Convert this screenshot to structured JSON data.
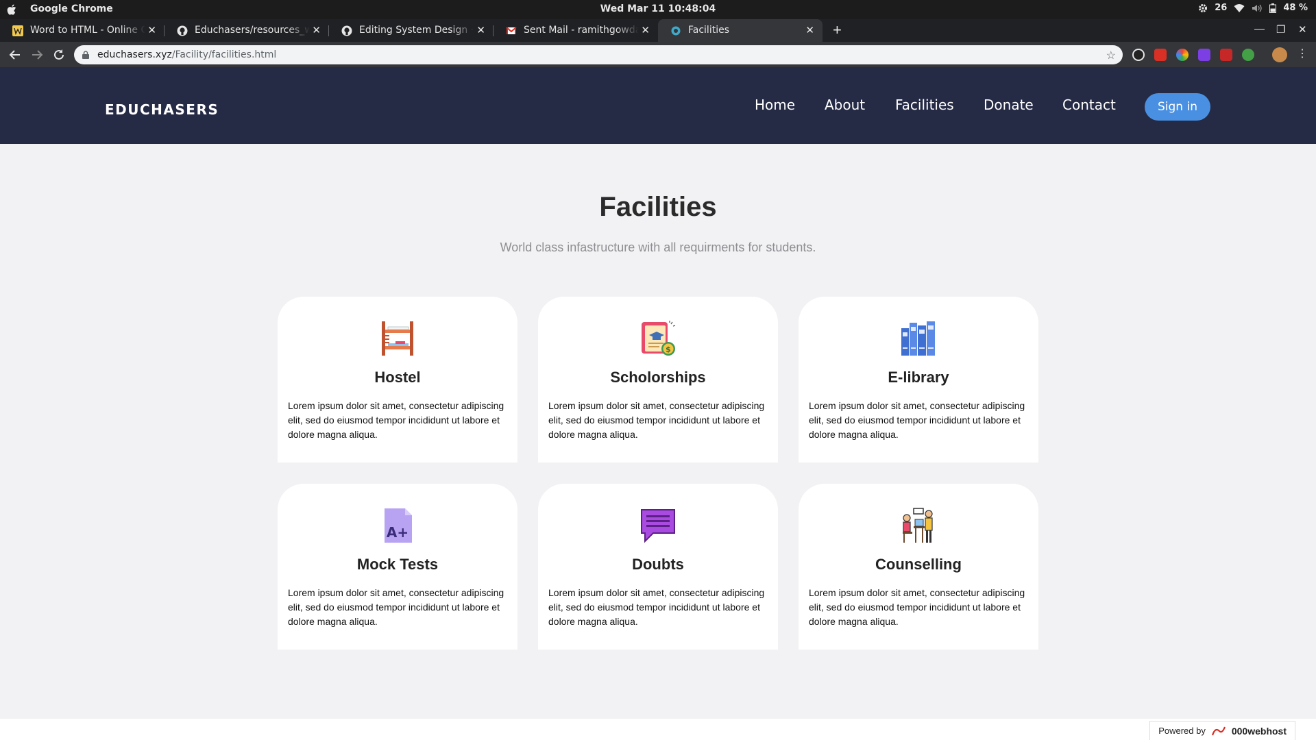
{
  "os": {
    "app_name": "Google Chrome",
    "clock": "Wed Mar 11  10:48:04",
    "tray_count": "26",
    "battery": "48 %"
  },
  "browser": {
    "tabs": [
      {
        "title": "Word to HTML - Online Co",
        "favicon": "w-icon"
      },
      {
        "title": "Educhasers/resources_wi",
        "favicon": "github-icon"
      },
      {
        "title": "Editing System Design · ra",
        "favicon": "github-icon"
      },
      {
        "title": "Sent Mail - ramithgowdak",
        "favicon": "gmail-icon"
      },
      {
        "title": "Facilities",
        "favicon": "site-icon"
      }
    ],
    "url_host": "educhasers.xyz",
    "url_path": "/Facility/facilities.html"
  },
  "site": {
    "logo": "EDUCHASERS",
    "nav": [
      "Home",
      "About",
      "Facilities",
      "Donate",
      "Contact"
    ],
    "signin_label": "Sign in",
    "title": "Facilities",
    "subtitle": "World class infastructure with all requirments for students.",
    "cards": [
      {
        "name": "Hostel",
        "icon": "bunk-bed-icon",
        "desc": "Lorem ipsum dolor sit amet, consectetur adipiscing elit, sed do eiusmod tempor incididunt ut labore et dolore magna aliqua."
      },
      {
        "name": "Scholorships",
        "icon": "scholarship-certificate-icon",
        "desc": "Lorem ipsum dolor sit amet, consectetur adipiscing elit, sed do eiusmod tempor incididunt ut labore et dolore magna aliqua."
      },
      {
        "name": "E-library",
        "icon": "bookshelf-icon",
        "desc": "Lorem ipsum dolor sit amet, consectetur adipiscing elit, sed do eiusmod tempor incididunt ut labore et dolore magna aliqua."
      },
      {
        "name": "Mock Tests",
        "icon": "grade-paper-icon",
        "desc": "Lorem ipsum dolor sit amet, consectetur adipiscing elit, sed do eiusmod tempor incididunt ut labore et dolore magna aliqua."
      },
      {
        "name": "Doubts",
        "icon": "chat-bubble-icon",
        "desc": "Lorem ipsum dolor sit amet, consectetur adipiscing elit, sed do eiusmod tempor incididunt ut labore et dolore magna aliqua."
      },
      {
        "name": "Counselling",
        "icon": "counsellor-desk-icon",
        "desc": "Lorem ipsum dolor sit amet, consectetur adipiscing elit, sed do eiusmod tempor incididunt ut labore et dolore magna aliqua."
      }
    ],
    "powered_by": "Powered by",
    "host_brand": "000webhost"
  },
  "colors": {
    "header_bg": "#252a45",
    "accent": "#4a90e2",
    "page_bg": "#f2f2f4"
  }
}
